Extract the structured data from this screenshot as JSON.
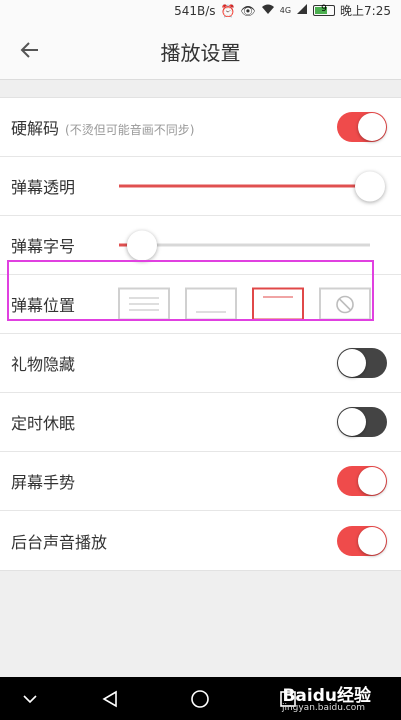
{
  "status_bar": {
    "speed": "541B/s",
    "alarm_icon": "alarm-icon",
    "eye_icon": "eye-icon",
    "wifi_icon": "wifi-icon",
    "network": "4G",
    "battery_level": "9",
    "time": "晚上7:25"
  },
  "header": {
    "back_icon": "arrow-left-icon",
    "title": "播放设置"
  },
  "settings": {
    "hardware_decode": {
      "label": "硬解码",
      "note": "(不烫但可能音画不同步)",
      "on": true
    },
    "danmaku_opacity": {
      "label": "弹幕透明",
      "value_percent": 100
    },
    "danmaku_font_size": {
      "label": "弹幕字号",
      "value_percent": 9
    },
    "danmaku_position": {
      "label": "弹幕位置",
      "options": [
        "full",
        "bottom",
        "top",
        "off"
      ],
      "selected": "top"
    },
    "gift_hide": {
      "label": "礼物隐藏",
      "on": false
    },
    "sleep_timer": {
      "label": "定时休眠",
      "on": false
    },
    "screen_gesture": {
      "label": "屏幕手势",
      "on": true
    },
    "background_audio": {
      "label": "后台声音播放",
      "on": true
    }
  },
  "colors": {
    "accent": "#ef4b4b",
    "toggle_off": "#444444",
    "highlight": "#e040e0"
  },
  "nav_bar": {
    "back_icon": "triangle-back-icon",
    "home_icon": "circle-home-icon",
    "recents_icon": "square-recents-icon",
    "down_icon": "chevron-down-icon"
  },
  "watermark": {
    "text": "Baidu经验",
    "url": "jingyan.baidu.com"
  }
}
